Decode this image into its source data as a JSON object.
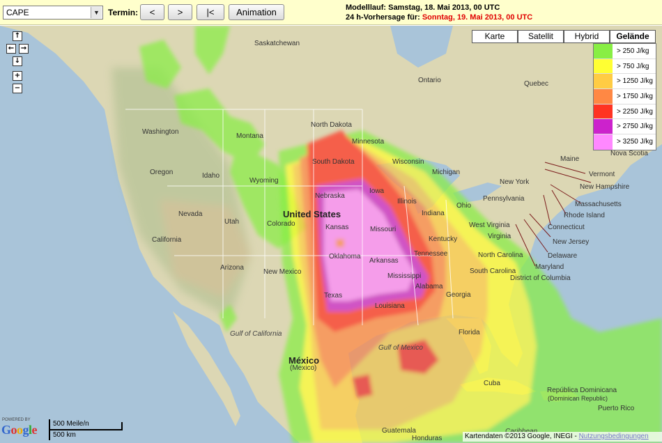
{
  "toolbar": {
    "parameter": "CAPE",
    "termin_label": "Termin:",
    "btn_prev": "<",
    "btn_next": ">",
    "btn_first": "|<",
    "btn_animation": "Animation",
    "model_run": "Modelllauf: Samstag, 18. Mai 2013, 00 UTC",
    "forecast_prefix": "24 h-Vorhersage für:",
    "forecast_date": "Sonntag, 19. Mai 2013, 00 UTC"
  },
  "map_types": [
    "Karte",
    "Satellit",
    "Hybrid",
    "Gelände"
  ],
  "active_map_type": "Gelände",
  "legend": [
    {
      "label": "> 250 J/kg",
      "color": "#88ee44"
    },
    {
      "label": "> 750 J/kg",
      "color": "#ffff33"
    },
    {
      "label": "> 1250 J/kg",
      "color": "#ffcc44"
    },
    {
      "label": "> 1750 J/kg",
      "color": "#ff8844"
    },
    {
      "label": "> 2250 J/kg",
      "color": "#ff3322"
    },
    {
      "label": "> 2750 J/kg",
      "color": "#cc22cc"
    },
    {
      "label": "> 3250 J/kg",
      "color": "#ff88ff"
    }
  ],
  "nav": {
    "up": "↑",
    "left": "←",
    "right": "→",
    "down": "↓",
    "zoom_in": "+",
    "zoom_out": "−"
  },
  "labels": {
    "saskatchewan": "Saskatchewan",
    "ontario": "Ontario",
    "quebec": "Quebec",
    "washington": "Washington",
    "montana": "Montana",
    "north_dakota": "North Dakota",
    "minnesota": "Minnesota",
    "south_dakota": "South Dakota",
    "wisconsin": "Wisconsin",
    "oregon": "Oregon",
    "idaho": "Idaho",
    "wyoming": "Wyoming",
    "michigan": "Michigan",
    "new_york": "New York",
    "maine": "Maine",
    "nova_scotia": "Nova Scotia",
    "vermont": "Vermont",
    "new_hampshire": "New Hampshire",
    "massachusetts": "Massachusetts",
    "rhode_island": "Rhode Island",
    "connecticut": "Connecticut",
    "new_jersey": "New Jersey",
    "delaware": "Delaware",
    "maryland": "Maryland",
    "district_of_columbia": "District of Columbia",
    "nevada": "Nevada",
    "utah": "Utah",
    "colorado": "Colorado",
    "united_states": "United States",
    "nebraska": "Nebraska",
    "iowa": "Iowa",
    "illinois": "Illinois",
    "indiana": "Indiana",
    "ohio": "Ohio",
    "pennsylvania": "Pennsylvania",
    "california": "California",
    "kansas": "Kansas",
    "missouri": "Missouri",
    "kentucky": "Kentucky",
    "west_virginia": "West Virginia",
    "virginia": "Virginia",
    "arizona": "Arizona",
    "new_mexico": "New Mexico",
    "oklahoma": "Oklahoma",
    "arkansas": "Arkansas",
    "tennessee": "Tennessee",
    "north_carolina": "North Carolina",
    "south_carolina": "South Carolina",
    "mississippi": "Mississippi",
    "alabama": "Alabama",
    "georgia": "Georgia",
    "texas": "Texas",
    "louisiana": "Louisiana",
    "florida": "Florida",
    "gulf_of_california": "Gulf of California",
    "gulf_of_mexico": "Gulf of Mexico",
    "mexico": "México",
    "mexico_sub": "(Mexico)",
    "cuba": "Cuba",
    "dominican": "República Dominicana",
    "dominican_sub": "(Dominican Republic)",
    "puerto_rico": "Puerto Rico",
    "guatemala": "Guatemala",
    "honduras": "Honduras",
    "caribbean": "Caribbean"
  },
  "branding": {
    "powered_by": "POWERED BY",
    "google": "Google",
    "scale_miles": "500 Meile/n",
    "scale_km": "500 km",
    "attribution": "Kartendaten ©2013 Google, INEGI - ",
    "terms_link": "Nutzungsbedingungen"
  }
}
